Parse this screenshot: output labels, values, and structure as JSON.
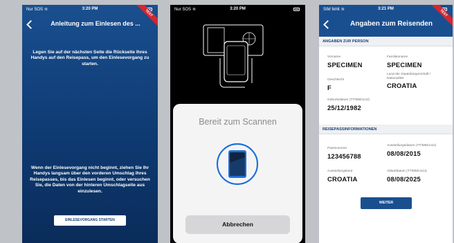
{
  "screen1": {
    "status": {
      "carrier": "Nur SOS",
      "time": "3:20 PM"
    },
    "ribbon": "TEST",
    "title": "Anleitung zum Einlesen des ...",
    "instruction_top": "Legen Sie auf der nächsten Seite die Rückseite Ihres Handys auf den Reisepass, um den Einlesevorgang zu starten.",
    "instruction_bottom": "Wenn der Einlesevorgang nicht beginnt, ziehen Sie Ihr Handys langsam über den vorderen Umschlag Ihres Reisepasses, bis das Einlesen beginnt, oder versuchen Sie, die Daten von der hinteren Umschlagseite aus einzulesen.",
    "start_button": "EINLESEVORGANG STARTEN"
  },
  "screen2": {
    "status": {
      "carrier": "Nur SOS",
      "time": "3:20 PM"
    },
    "sheet_title": "Bereit zum Scannen",
    "cancel_button": "Abbrechen",
    "scan_icon": "phone-scan-icon"
  },
  "screen3": {
    "status": {
      "carrier": "SIM fehlt",
      "time": "3:21 PM"
    },
    "ribbon": "TEST",
    "title": "Angaben zum Reisenden",
    "section_person": "ANGABEN ZUR PERSON",
    "vorname_label": "Vorname",
    "vorname": "SPECIMEN",
    "familienname_label": "Familienname",
    "familienname": "SPECIMEN",
    "geschlecht_label": "Geschlecht",
    "geschlecht": "F",
    "staat_label": "Land der Staatsbürgerschaft / Nationalität",
    "staat": "CROATIA",
    "geburtsdatum_label": "Geburtsdatum (TT/MM/JJJJ)",
    "geburtsdatum": "25/12/1982",
    "section_passport": "REISEPASSINFORMATIONEN",
    "passnummer_label": "Passnummer",
    "passnummer": "123456788",
    "ausstellungsdatum_label": "Ausstellungsdatum (TT/MM/JJJJ)",
    "ausstellungsdatum": "08/08/2015",
    "ausstellungsland_label": "Ausstellungsland",
    "ausstellungsland": "CROATIA",
    "ablaufdatum_label": "Ablaufdatum (TT/MM/JJJJ)",
    "ablaufdatum": "08/08/2025",
    "weiter_button": "WEITER"
  },
  "colors": {
    "brand_blue": "#1a4f8f",
    "ribbon_red": "#d6262e",
    "scan_blue": "#1e6fd8"
  }
}
